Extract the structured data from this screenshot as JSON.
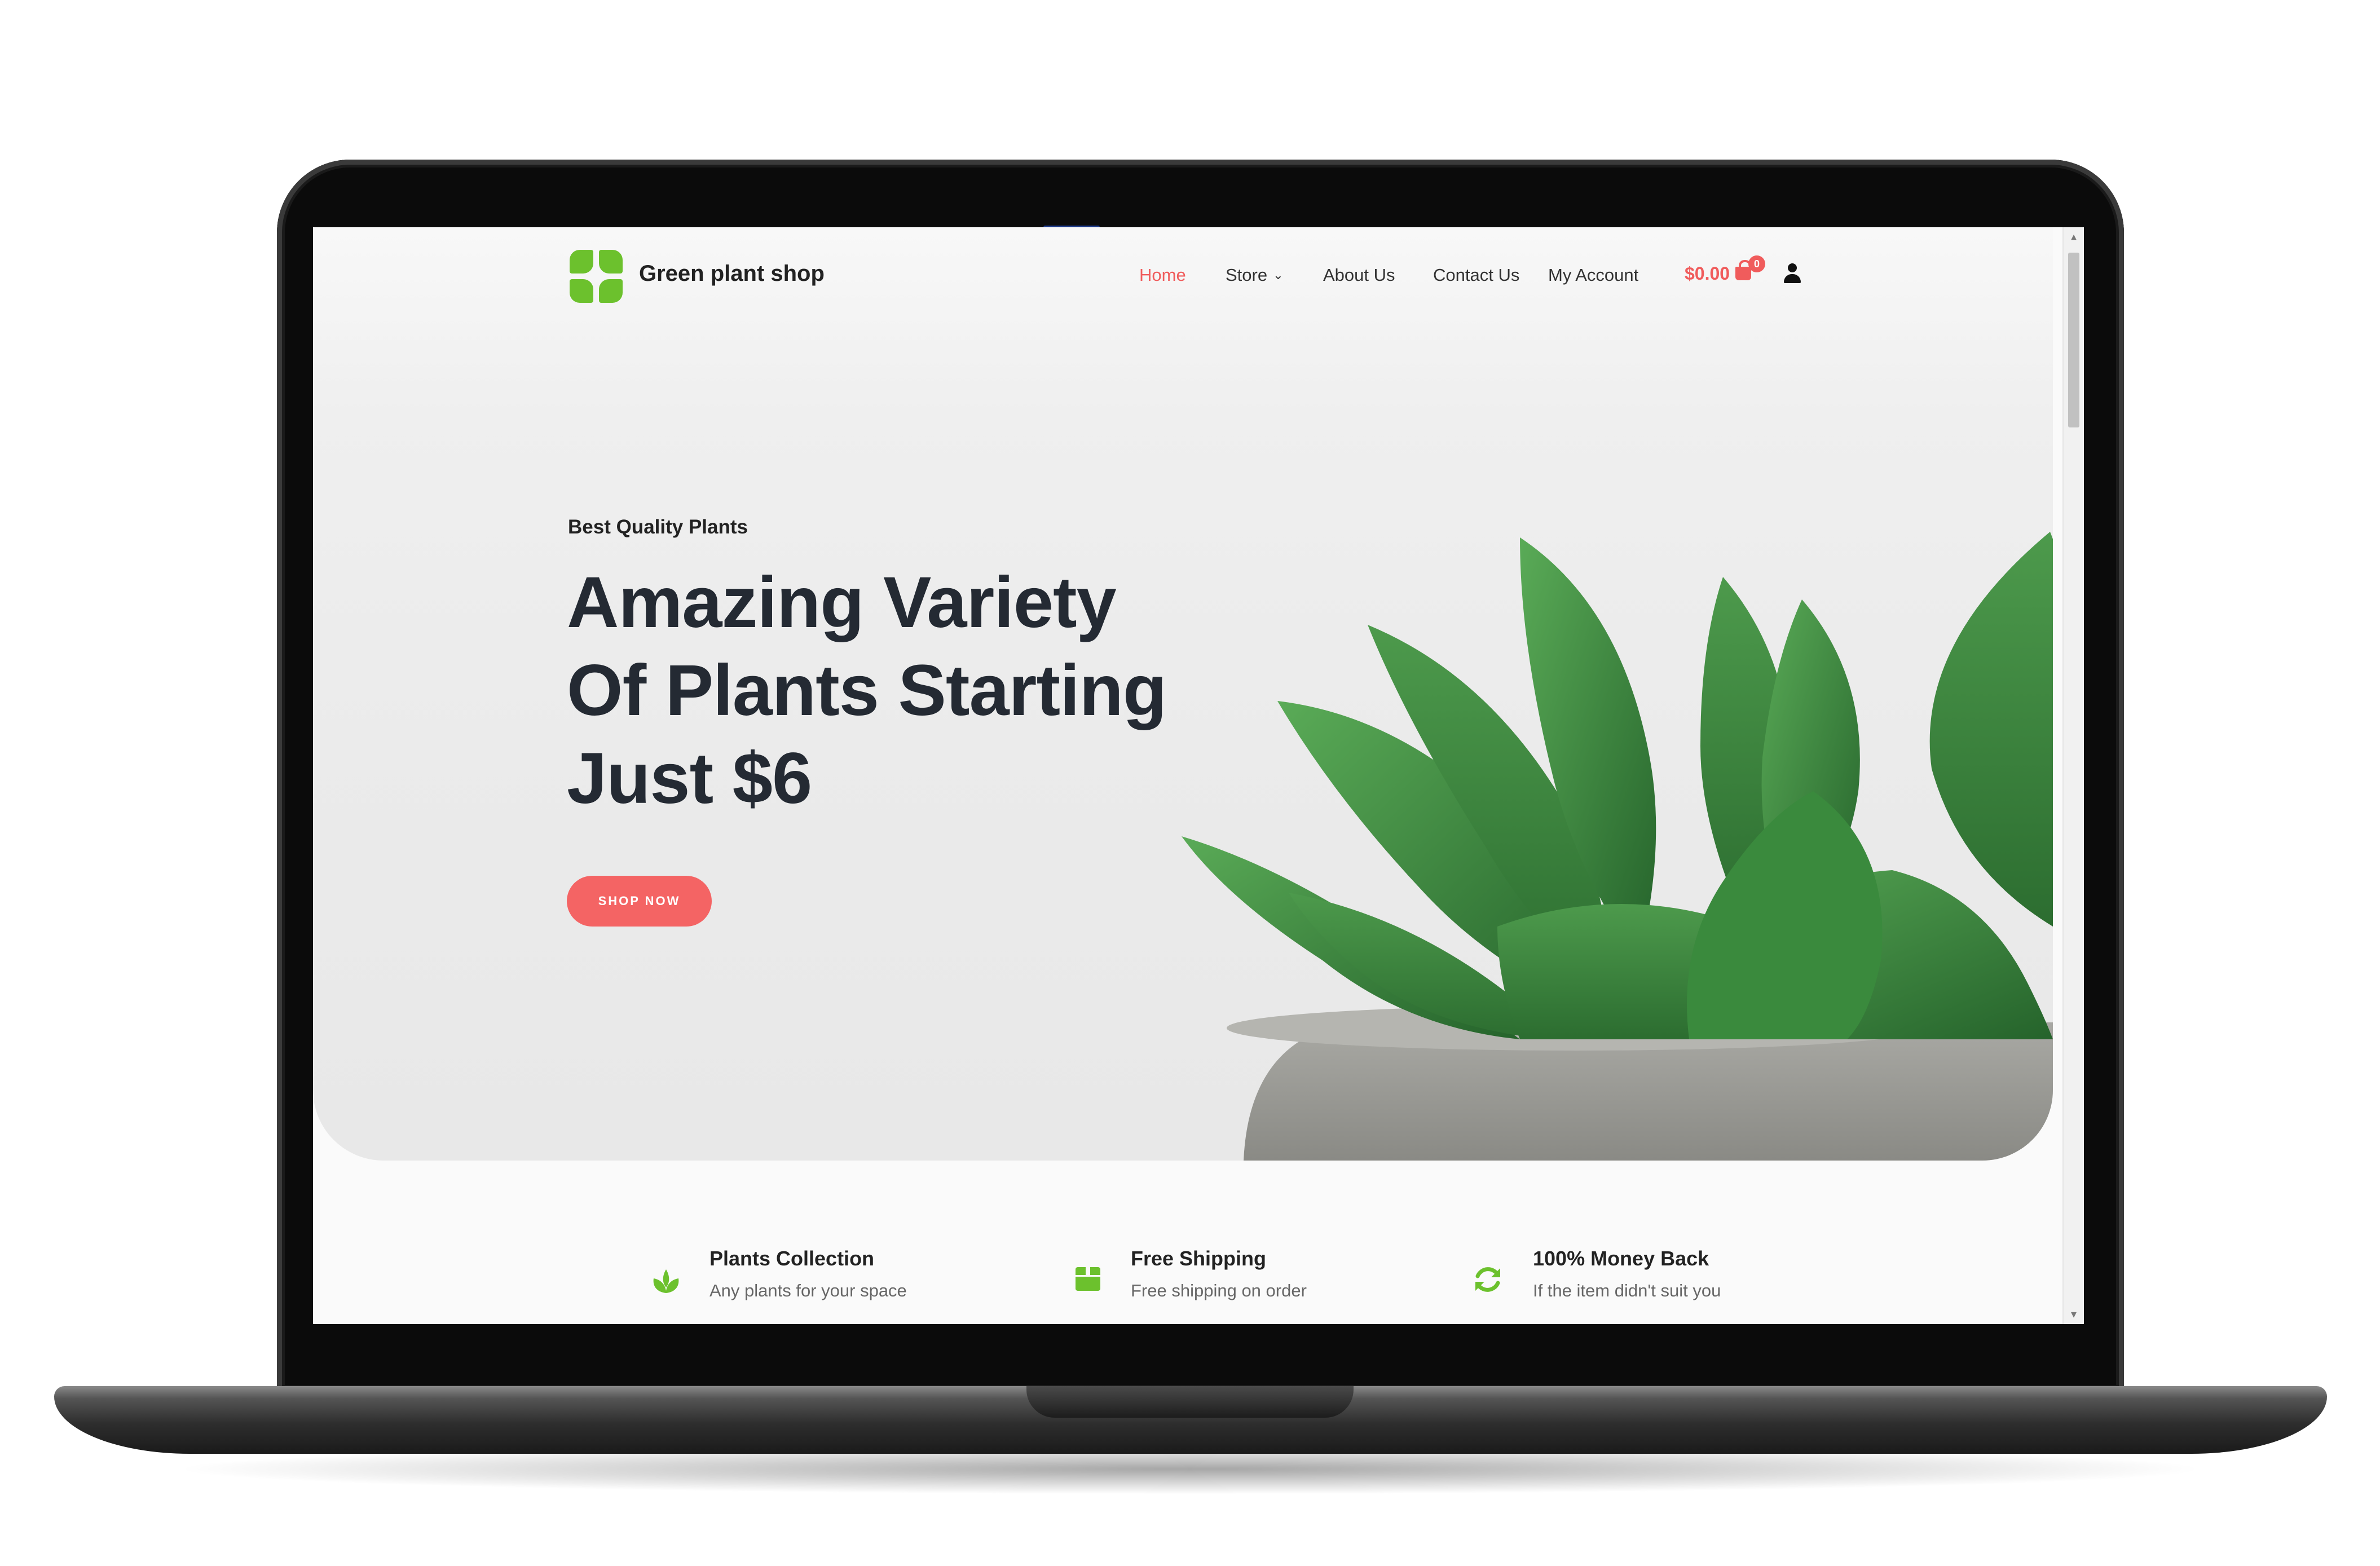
{
  "site": {
    "name": "Green plant shop"
  },
  "nav": {
    "items": [
      {
        "label": "Home",
        "active": true
      },
      {
        "label": "Store",
        "dropdown": true
      },
      {
        "label": "About Us"
      },
      {
        "label": "Contact Us"
      },
      {
        "label": "My Account"
      }
    ],
    "cart_amount": "$0.00",
    "cart_count": "0",
    "chevron_icon": "chevron-down-icon",
    "cart_icon": "shopping-bag-icon",
    "user_icon": "user-icon"
  },
  "hero": {
    "eyebrow": "Best Quality Plants",
    "headline_lines": [
      "Amazing Variety",
      "Of Plants Starting",
      "Just $6"
    ],
    "cta_label": "SHOP NOW"
  },
  "features": [
    {
      "icon": "sprout-icon",
      "title": "Plants Collection",
      "desc": "Any plants for your space"
    },
    {
      "icon": "box-icon",
      "title": "Free Shipping",
      "desc": "Free shipping on order"
    },
    {
      "icon": "refresh-icon",
      "title": "100% Money Back",
      "desc": "If the item didn't suit you"
    }
  ],
  "colors": {
    "accent": "#f05c5c",
    "brand_green": "#6cc12d",
    "heading": "#242a33",
    "hero_bg": "#ebebeb"
  }
}
